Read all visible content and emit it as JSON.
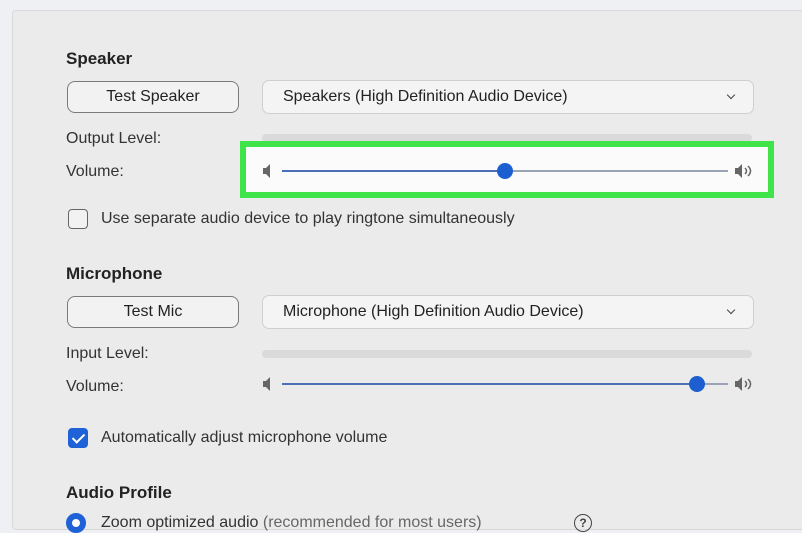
{
  "speaker": {
    "title": "Speaker",
    "test_button": "Test Speaker",
    "device": "Speakers (High Definition Audio Device)",
    "output_level_label": "Output Level:",
    "volume_label": "Volume:",
    "volume_level": 0.5
  },
  "ringtone": {
    "label": "Use separate audio device to play ringtone simultaneously",
    "checked": false
  },
  "microphone": {
    "title": "Microphone",
    "test_button": "Test Mic",
    "device": "Microphone (High Definition Audio Device)",
    "input_level_label": "Input Level:",
    "volume_label": "Volume:",
    "volume_level": 0.93
  },
  "auto_adjust": {
    "label": "Automatically adjust microphone volume",
    "checked": true
  },
  "audio_profile": {
    "title": "Audio Profile",
    "option_label": "Zoom optimized audio",
    "option_note": "(recommended for most users)",
    "help_glyph": "?"
  },
  "colors": {
    "highlight": "#3fe34a",
    "accent": "#1f61d6"
  }
}
